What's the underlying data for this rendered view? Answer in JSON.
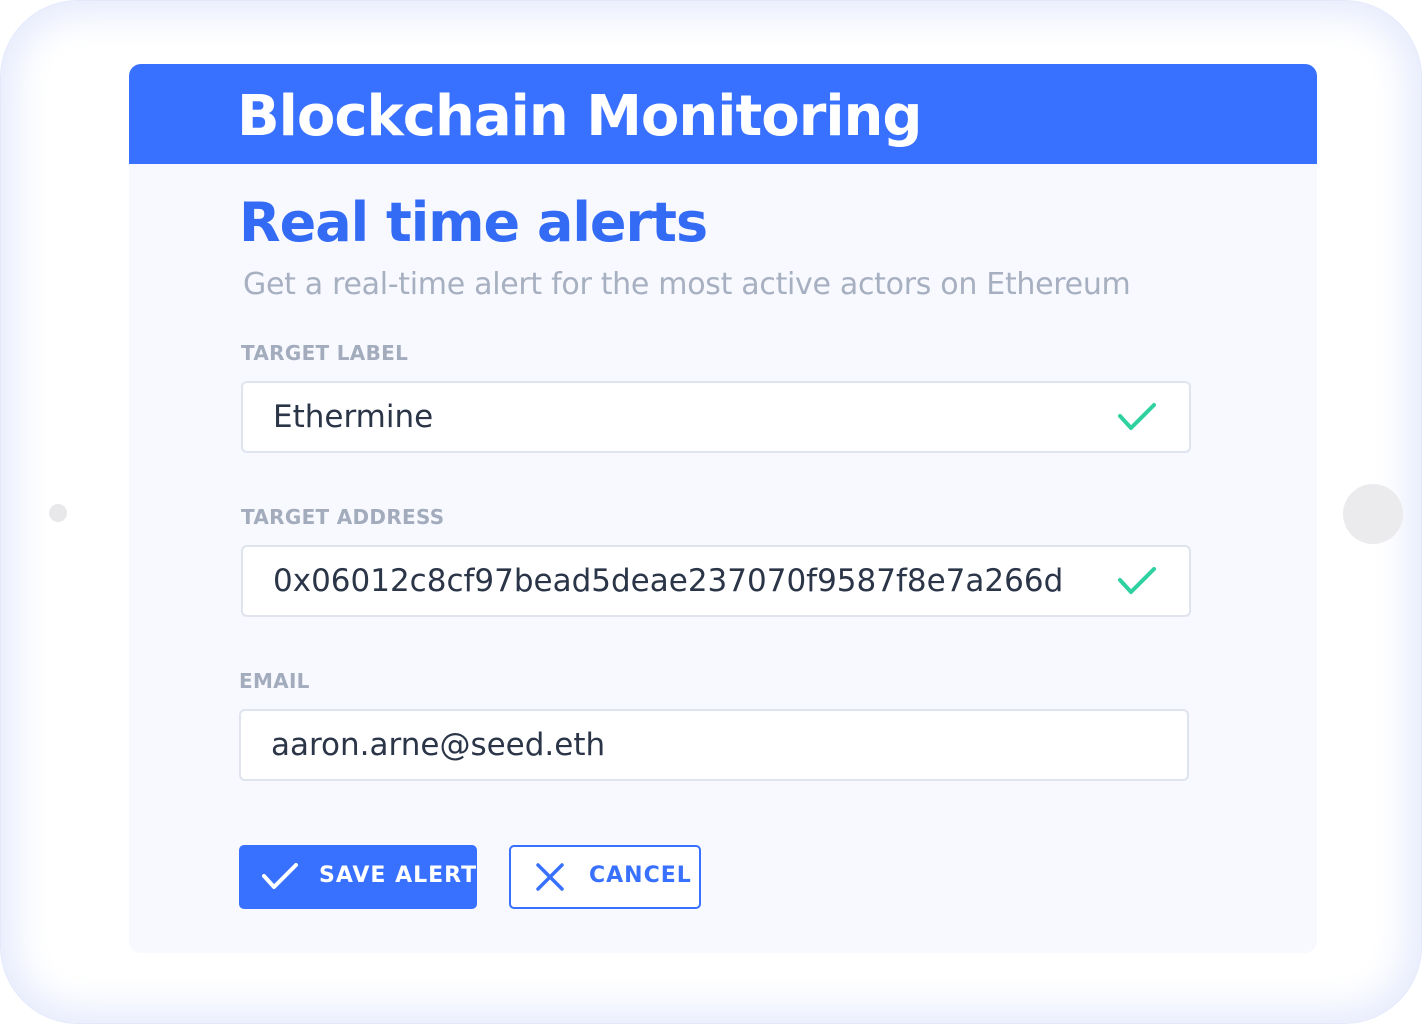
{
  "header": {
    "title": "Blockchain Monitoring"
  },
  "form": {
    "title": "Real time alerts",
    "subtitle": "Get a real-time alert for the most active actors on Ethereum",
    "fields": [
      {
        "label": "TARGET LABEL",
        "value": "Ethermine",
        "valid": true
      },
      {
        "label": "TARGET ADDRESS",
        "value": "0x06012c8cf97bead5deae237070f9587f8e7a266d",
        "valid": true
      },
      {
        "label": "EMAIL",
        "value": "aaron.arne@seed.eth",
        "valid": false
      }
    ]
  },
  "actions": {
    "save_label": "SAVE ALERT",
    "save_icon": "check-icon",
    "cancel_label": "CANCEL",
    "cancel_icon": "close-icon"
  },
  "colors": {
    "accent": "#3870ff",
    "valid": "#2fd1a0",
    "label": "#a3acbd"
  }
}
